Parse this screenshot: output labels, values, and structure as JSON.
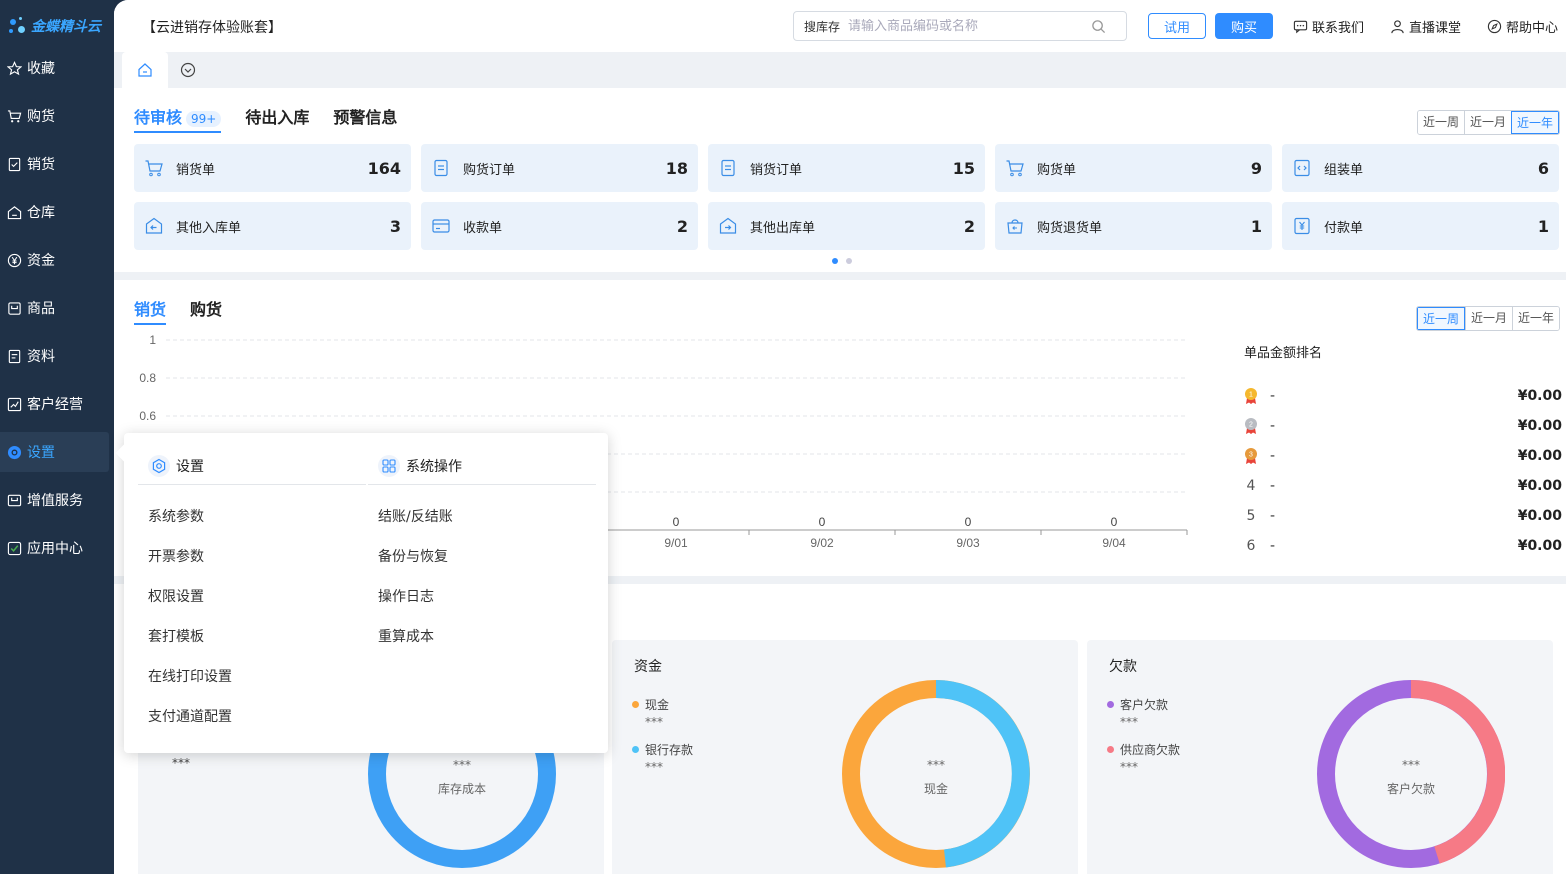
{
  "brand": {
    "logo_text": "金蝶精斗云"
  },
  "sidebar": {
    "items": [
      {
        "label": "收藏",
        "icon": "star-icon"
      },
      {
        "label": "购货",
        "icon": "cart-icon"
      },
      {
        "label": "销货",
        "icon": "document-icon"
      },
      {
        "label": "仓库",
        "icon": "warehouse-icon"
      },
      {
        "label": "资金",
        "icon": "yen-icon"
      },
      {
        "label": "商品",
        "icon": "box-icon"
      },
      {
        "label": "资料",
        "icon": "file-icon"
      },
      {
        "label": "客户经营",
        "icon": "chart-icon"
      },
      {
        "label": "设置",
        "icon": "settings-icon",
        "active": true
      },
      {
        "label": "增值服务",
        "icon": "service-icon"
      },
      {
        "label": "应用中心",
        "icon": "app-icon"
      }
    ]
  },
  "topbar": {
    "account": "【云进销存体验账套】",
    "search_label": "搜库存",
    "search_placeholder": "请输入商品编码或名称",
    "trial": "试用",
    "buy": "购买",
    "contact": "联系我们",
    "live": "直播课堂",
    "help": "帮助中心"
  },
  "pending": {
    "tabs": [
      "待审核",
      "待出入库",
      "预警信息"
    ],
    "badge": "99+",
    "ranges": [
      "近一周",
      "近一月",
      "近一年"
    ],
    "cards": [
      {
        "label": "销货单",
        "value": "164"
      },
      {
        "label": "购货订单",
        "value": "18"
      },
      {
        "label": "销货订单",
        "value": "15"
      },
      {
        "label": "购货单",
        "value": "9"
      },
      {
        "label": "组装单",
        "value": "6"
      },
      {
        "label": "其他入库单",
        "value": "3"
      },
      {
        "label": "收款单",
        "value": "2"
      },
      {
        "label": "其他出库单",
        "value": "2"
      },
      {
        "label": "购货退货单",
        "value": "1"
      },
      {
        "label": "付款单",
        "value": "1"
      }
    ]
  },
  "sales": {
    "tabs": [
      "销货",
      "购货"
    ],
    "ranges": [
      "近一周",
      "近一月",
      "近一年"
    ],
    "rank_title": "单品金额排名",
    "rank": [
      {
        "no": "1",
        "name": "-",
        "value": "¥0.00"
      },
      {
        "no": "2",
        "name": "-",
        "value": "¥0.00"
      },
      {
        "no": "3",
        "name": "-",
        "value": "¥0.00"
      },
      {
        "no": "4",
        "name": "-",
        "value": "¥0.00"
      },
      {
        "no": "5",
        "name": "-",
        "value": "¥0.00"
      },
      {
        "no": "6",
        "name": "-",
        "value": "¥0.00"
      }
    ]
  },
  "chart_data": {
    "type": "line",
    "categories": [
      "9/01",
      "9/02",
      "9/03",
      "9/04"
    ],
    "values": [
      0,
      0,
      0,
      0
    ],
    "data_labels": [
      "0",
      "0",
      "0",
      "0"
    ],
    "y_ticks": [
      "1",
      "0.8",
      "0.6"
    ],
    "ylim": [
      0,
      1
    ],
    "grid": true
  },
  "stats": {
    "inventory": {
      "extra": "***",
      "center_value": "***",
      "center_label": "库存成本"
    },
    "funds": {
      "title": "资金",
      "legend": [
        {
          "label": "现金",
          "value": "***",
          "color": "#fba63c"
        },
        {
          "label": "银行存款",
          "value": "***",
          "color": "#4fc3f7"
        }
      ],
      "center_value": "***",
      "center_label": "现金"
    },
    "debt": {
      "title": "欠款",
      "legend": [
        {
          "label": "客户欠款",
          "value": "***",
          "color": "#a26ae0"
        },
        {
          "label": "供应商欠款",
          "value": "***",
          "color": "#f67a86"
        }
      ],
      "center_value": "***",
      "center_label": "客户欠款"
    }
  },
  "popup": {
    "settings_title": "设置",
    "settings_items": [
      "系统参数",
      "开票参数",
      "权限设置",
      "套打模板",
      "在线打印设置",
      "支付通道配置"
    ],
    "ops_title": "系统操作",
    "ops_items": [
      "结账/反结账",
      "备份与恢复",
      "操作日志",
      "重算成本"
    ]
  }
}
